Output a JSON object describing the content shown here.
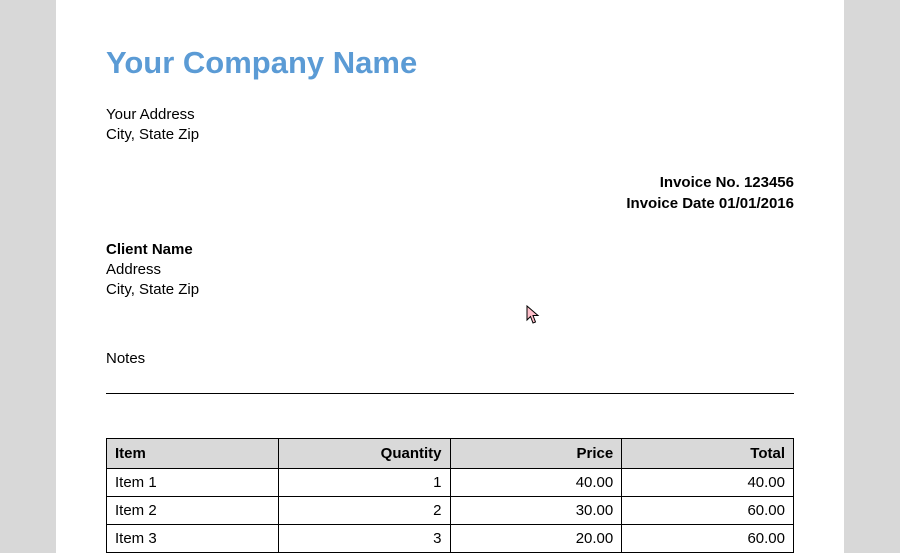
{
  "company": {
    "name": "Your Company Name",
    "address_line1": "Your Address",
    "address_line2": "City, State Zip"
  },
  "invoice_meta": {
    "number_label": "Invoice No.",
    "number": "123456",
    "date_label": "Invoice Date",
    "date": "01/01/2016"
  },
  "client": {
    "name": "Client Name",
    "address_line1": "Address",
    "address_line2": "City, State Zip"
  },
  "notes_label": "Notes",
  "table": {
    "headers": {
      "item": "Item",
      "quantity": "Quantity",
      "price": "Price",
      "total": "Total"
    },
    "rows": [
      {
        "item": "Item 1",
        "quantity": "1",
        "price": "40.00",
        "total": "40.00"
      },
      {
        "item": "Item 2",
        "quantity": "2",
        "price": "30.00",
        "total": "60.00"
      },
      {
        "item": "Item 3",
        "quantity": "3",
        "price": "20.00",
        "total": "60.00"
      }
    ]
  }
}
